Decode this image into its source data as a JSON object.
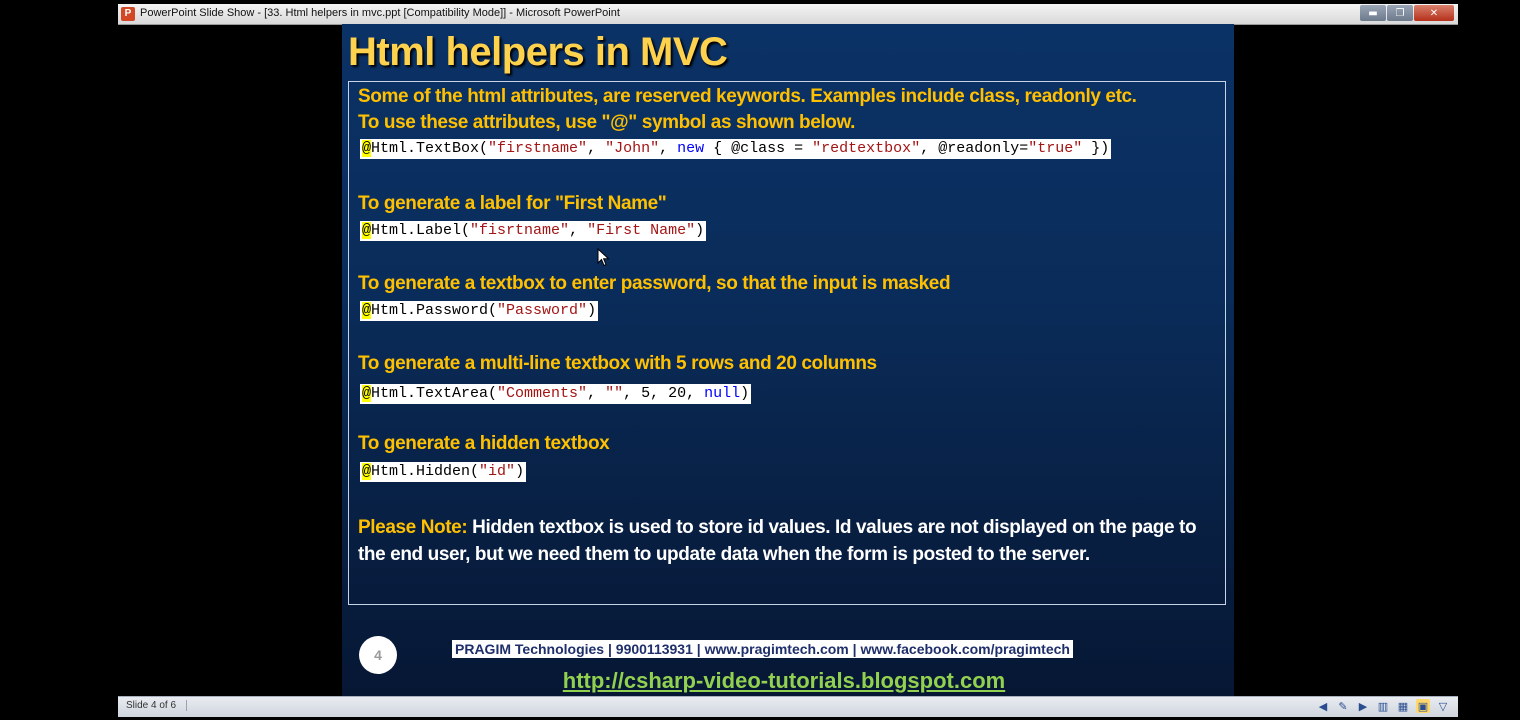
{
  "window": {
    "title": "PowerPoint Slide Show - [33. Html helpers in mvc.ppt [Compatibility Mode]] - Microsoft PowerPoint",
    "app_icon_letter": "P",
    "minimize": "▬",
    "restore": "❐",
    "close": "✕"
  },
  "slide": {
    "title": "Html helpers in MVC",
    "intro_line1": "Some of the html attributes, are reserved keywords. Examples include class, readonly etc.",
    "intro_line2": "To use these attributes, use \"@\" symbol as shown below.",
    "code1": {
      "at": "@",
      "p1": "Html.TextBox(",
      "s1": "\"firstname\"",
      "p2": ", ",
      "s2": "\"John\"",
      "p3": ", ",
      "kw": "new",
      "p4": " { @class = ",
      "s3": "\"redtextbox\"",
      "p5": ", @readonly=",
      "s4": "\"true\"",
      "p6": " })"
    },
    "heading_label": "To generate a label for \"First Name\"",
    "code2": {
      "at": "@",
      "p1": "Html.Label(",
      "s1": "\"fisrtname\"",
      "p2": ", ",
      "s2": "\"First Name\"",
      "p3": ")"
    },
    "heading_password": "To generate a textbox to enter password, so that the input is masked",
    "code3": {
      "at": "@",
      "p1": "Html.Password(",
      "s1": "\"Password\"",
      "p2": ")"
    },
    "heading_textarea": "To generate a multi-line textbox with 5 rows and 20 columns",
    "code4": {
      "at": "@",
      "p1": "Html.TextArea(",
      "s1": "\"Comments\"",
      "p2": ", ",
      "s2": "\"\"",
      "p3": ", 5, 20, ",
      "kw": "null",
      "p4": ")"
    },
    "heading_hidden": "To generate a hidden textbox",
    "code5": {
      "at": "@",
      "p1": "Html.Hidden(",
      "s1": "\"id\"",
      "p2": ")"
    },
    "note_label": "Please  Note: ",
    "note_text": "Hidden textbox is used to store id values. Id values are not displayed on the page to the end user, but we need them to update data when the form is posted to the server.",
    "page_number": "4",
    "footer": "PRAGIM Technologies | 9900113931 | www.pragimtech.com | www.facebook.com/pragimtech",
    "link": "http://csharp-video-tutorials.blogspot.com"
  },
  "statusbar": {
    "slide_counter": "Slide 4 of 6"
  },
  "colors": {
    "title": "#ffd24d",
    "body_text": "#ffc000",
    "note_text": "#ffffff",
    "link": "#92d050",
    "slide_bg": "#0a2c5a"
  }
}
